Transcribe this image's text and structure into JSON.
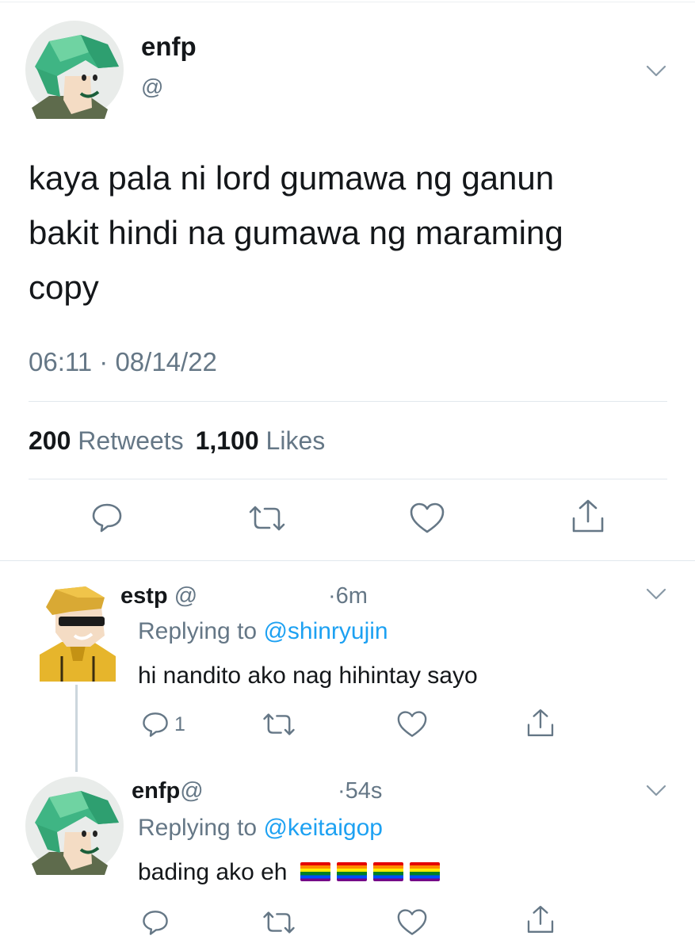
{
  "main_tweet": {
    "name": "enfp",
    "handle": "@",
    "text_lines": [
      "kaya pala ni lord gumawa ng ganun",
      "bakit hindi na gumawa ng maraming",
      "copy"
    ],
    "timestamp": "06:11 · 08/14/22",
    "retweets_count": "200",
    "retweets_label": "Retweets",
    "likes_count": "1,100",
    "likes_label": "Likes"
  },
  "replies": [
    {
      "name": "estp",
      "handle": "@",
      "time": "·6m",
      "replying_prefix": "Replying to",
      "replying_to": "@shinryujin",
      "text": "hi nandito ako nag hihintay sayo",
      "reply_count": "1",
      "flags": []
    },
    {
      "name": "enfp",
      "handle": "@",
      "time": "·54s",
      "replying_prefix": "Replying to",
      "replying_to": "@keitaigop",
      "text": "bading ako eh",
      "reply_count": "",
      "flags": [
        "rainbow-flag",
        "rainbow-flag",
        "rainbow-flag",
        "rainbow-flag"
      ]
    }
  ],
  "colors": {
    "text": "#14171a",
    "muted": "#657786",
    "link": "#1da1f2",
    "divider": "#e1e8ed"
  }
}
